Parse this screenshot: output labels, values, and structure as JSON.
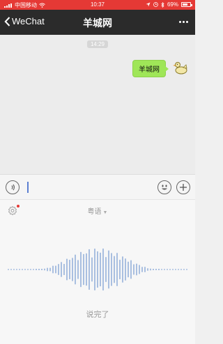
{
  "status_bar": {
    "carrier": "中国移动",
    "time": "10:37",
    "battery": "69%",
    "battery_level": 0.69
  },
  "nav": {
    "back_label": "WeChat",
    "title": "羊城网"
  },
  "chat": {
    "timestamp": "14:29",
    "message": "羊城网"
  },
  "voice_input": {
    "language": "粤语",
    "done_label": "说完了"
  },
  "colors": {
    "status_bar": "#e53935",
    "nav_bar": "#2b2b2b",
    "bubble": "#9fe658",
    "wave": "#a9bfe0"
  },
  "icons": {
    "back": "chevron-left-icon",
    "more": "more-icon",
    "voice": "voice-icon",
    "emoji": "emoji-icon",
    "plus": "plus-icon",
    "settings": "gear-icon",
    "dropdown": "chevron-down-icon"
  }
}
